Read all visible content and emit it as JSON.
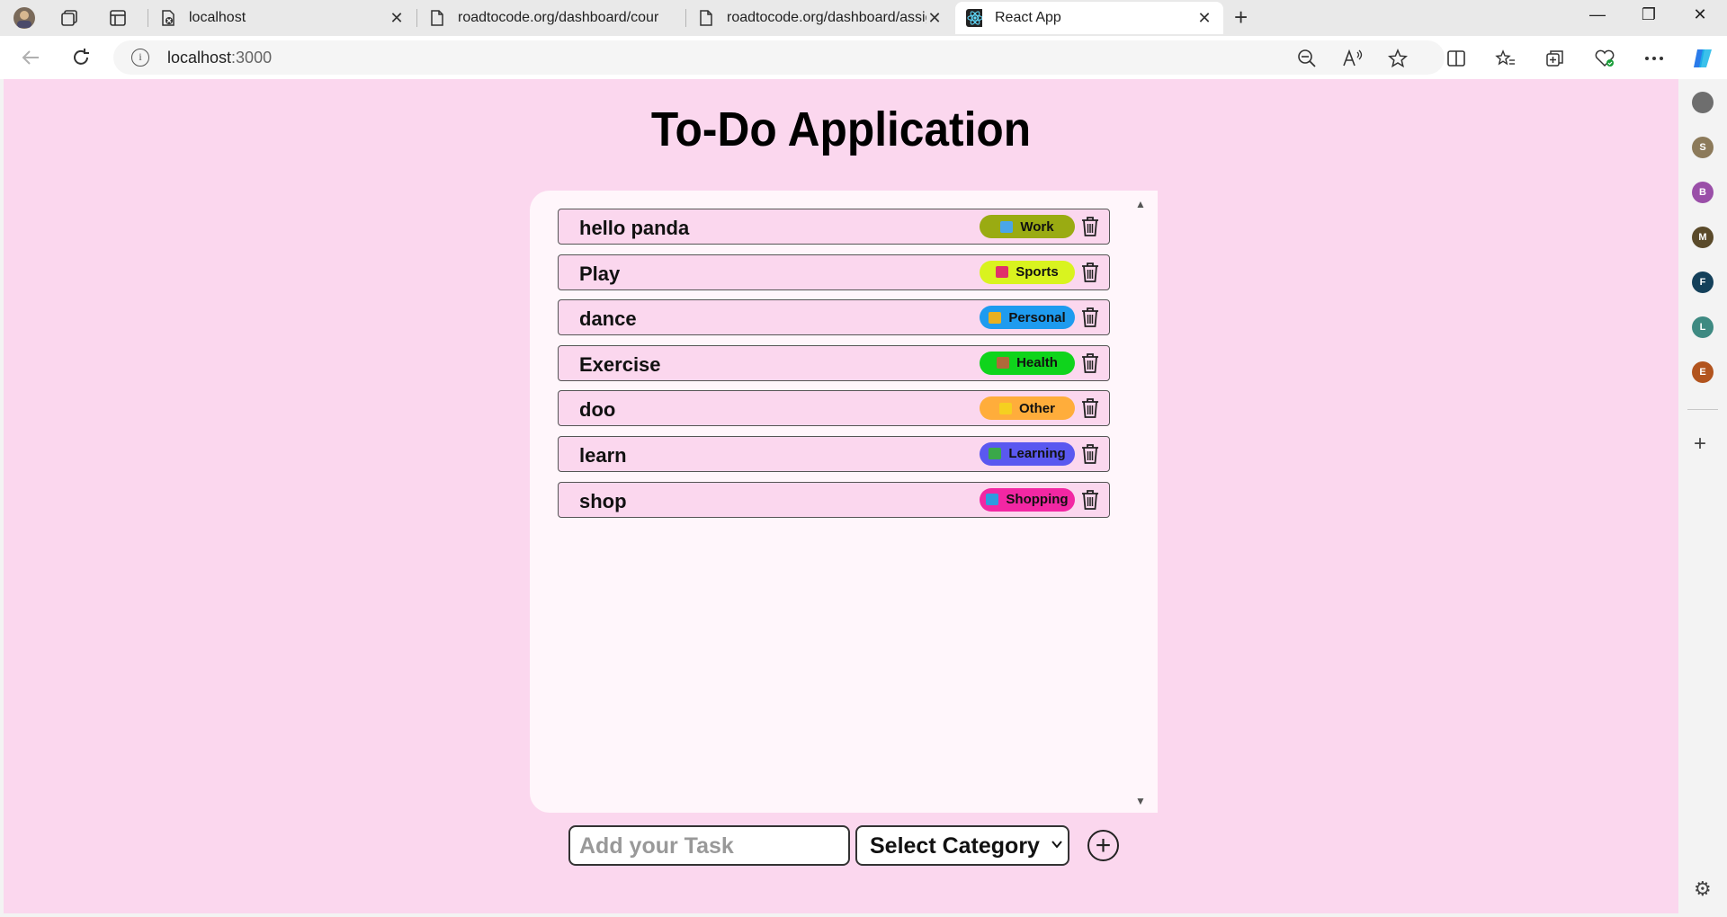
{
  "browser": {
    "tabs": [
      {
        "title": "localhost",
        "close": "✕"
      },
      {
        "title": "roadtocode.org/dashboard/cour",
        "close": ""
      },
      {
        "title": "roadtocode.org/dashboard/assig",
        "close": "✕"
      },
      {
        "title": "React App",
        "close": "✕"
      }
    ],
    "new_tab": "+",
    "window_controls": {
      "minimize": "—",
      "restore": "❐",
      "close": "✕"
    },
    "address": {
      "host": "localhost",
      "port": ":3000",
      "info": "i"
    },
    "toolbar_icons": [
      "zoom-out-icon",
      "read-aloud-icon",
      "favorite-star-icon",
      "split-screen-icon",
      "favorites-icon",
      "collections-icon",
      "browser-essentials-icon",
      "more-icon",
      "copilot-icon"
    ]
  },
  "sidebar": {
    "avatars": [
      {
        "letter": "",
        "color": "#6e6e6e"
      },
      {
        "letter": "S",
        "color": "#8c7a5a"
      },
      {
        "letter": "B",
        "color": "#9a4fa8"
      },
      {
        "letter": "M",
        "color": "#5a4a2a"
      },
      {
        "letter": "F",
        "color": "#14405a"
      },
      {
        "letter": "L",
        "color": "#3e8a82"
      },
      {
        "letter": "E",
        "color": "#b2541e"
      }
    ],
    "add": "+",
    "settings": "⚙"
  },
  "app": {
    "title": "To-Do Application",
    "tasks": [
      {
        "name": "hello panda",
        "category": "Work",
        "color": "#9aab12",
        "emoji_color": "#4aa6e8"
      },
      {
        "name": "Play",
        "category": "Sports",
        "color": "#d9f31f",
        "emoji_color": "#e0306a"
      },
      {
        "name": "dance",
        "category": "Personal",
        "color": "#1e9bef",
        "emoji_color": "#e8b020"
      },
      {
        "name": "Exercise",
        "category": "Health",
        "color": "#0fd41c",
        "emoji_color": "#b06a3a"
      },
      {
        "name": "doo",
        "category": "Other",
        "color": "#ffad3b",
        "emoji_color": "#f5d020"
      },
      {
        "name": "learn",
        "category": "Learning",
        "color": "#5a58f0",
        "emoji_color": "#3aa84a"
      },
      {
        "name": "shop",
        "category": "Shopping",
        "color": "#f227a3",
        "emoji_color": "#2e9be0"
      }
    ],
    "input_placeholder": "Add your Task",
    "select_label": "Select Category",
    "add_button": "+"
  }
}
